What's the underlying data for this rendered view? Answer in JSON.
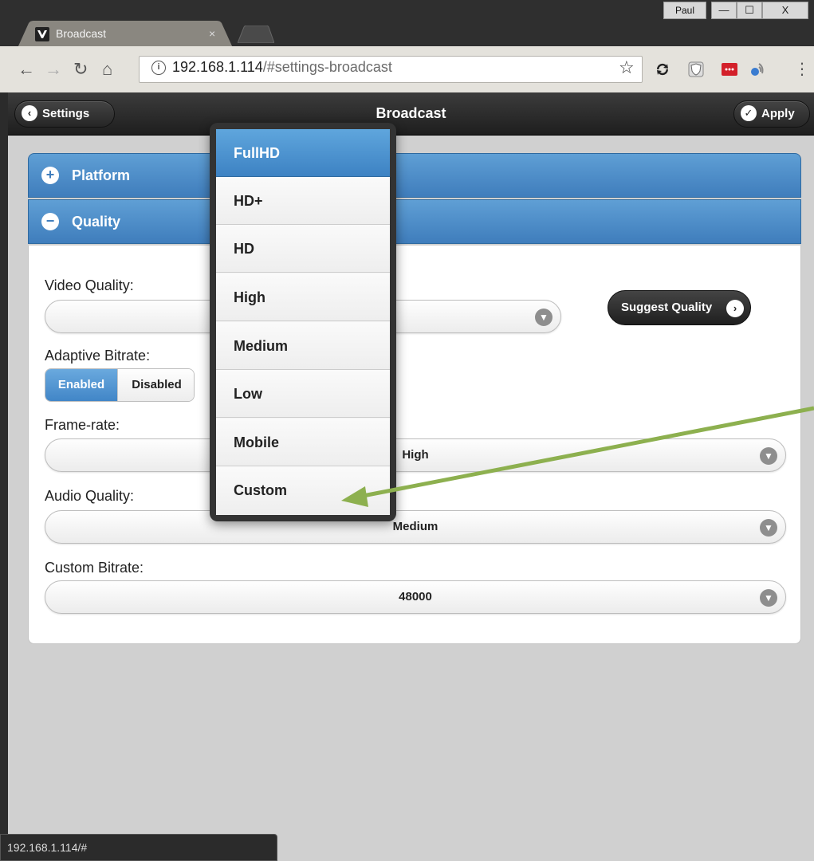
{
  "browser": {
    "tab_title": "Broadcast",
    "tab_close": "×",
    "user_name": "Paul",
    "window_buttons": {
      "minimize": "—",
      "maximize": "☐",
      "close": "X"
    },
    "url_host": "192.168.1.114",
    "url_rest": "/#settings-broadcast",
    "status_url": "192.168.1.114/#"
  },
  "header": {
    "back_label": "Settings",
    "title": "Broadcast",
    "apply_label": "Apply"
  },
  "sections": {
    "platform": {
      "label": "Platform",
      "state_icon": "+"
    },
    "quality": {
      "label": "Quality",
      "state_icon": "−"
    }
  },
  "form": {
    "video_quality": {
      "label": "Video Quality:",
      "value": ""
    },
    "suggest_label": "Suggest Quality",
    "adaptive_bitrate": {
      "label": "Adaptive Bitrate:",
      "enabled": "Enabled",
      "disabled": "Disabled"
    },
    "frame_rate": {
      "label": "Frame-rate:",
      "value": "High"
    },
    "audio_quality": {
      "label": "Audio Quality:",
      "value": "Medium"
    },
    "custom_bitrate": {
      "label": "Custom Bitrate:",
      "value": "48000"
    }
  },
  "dropdown": {
    "options": [
      "FullHD",
      "HD+",
      "HD",
      "High",
      "Medium",
      "Low",
      "Mobile",
      "Custom"
    ],
    "selected": "FullHD"
  },
  "colors": {
    "accent_blue": "#3f7dbc",
    "annotation_arrow": "#8db04f"
  }
}
